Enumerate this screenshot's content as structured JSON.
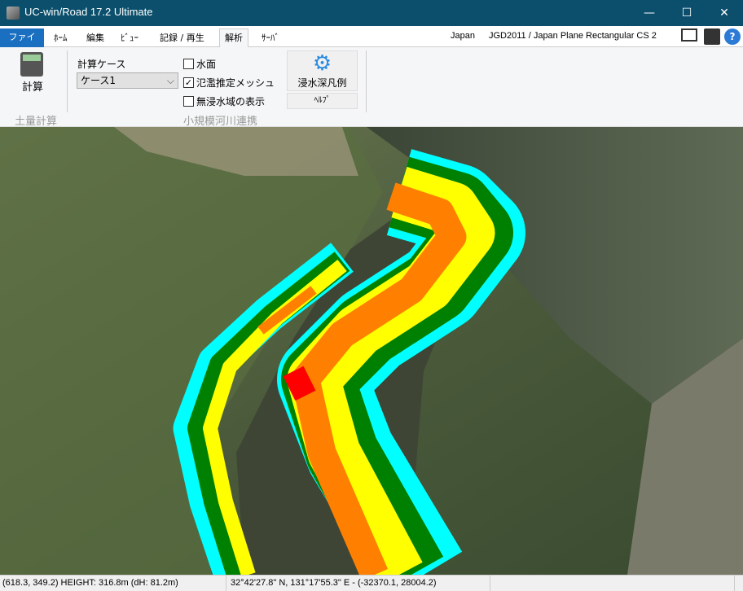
{
  "window": {
    "title": "UC-win/Road 17.2 Ultimate",
    "minimize": "—",
    "maximize": "☐",
    "close": "✕"
  },
  "tabs": [
    {
      "label": "ファイル"
    },
    {
      "label": "ﾎｰﾑ"
    },
    {
      "label": "編集"
    },
    {
      "label": "ﾋﾞｭｰ"
    },
    {
      "label": "記録 / 再生"
    },
    {
      "label": "解析"
    },
    {
      "label": "ｻｰﾊﾞ"
    }
  ],
  "header": {
    "region": "Japan",
    "crs": "JGD2011 / Japan Plane Rectangular CS 2"
  },
  "ribbon": {
    "calc_button": "計算",
    "group1": "土量計算",
    "case_label": "計算ケース",
    "case_value": "ケース1",
    "checkboxes": [
      {
        "label": "水面",
        "checked": false
      },
      {
        "label": "氾濫推定メッシュ",
        "checked": true
      },
      {
        "label": "無浸水域の表示",
        "checked": false
      }
    ],
    "legend_button": "浸水深凡例",
    "help_button": "ﾍﾙﾌﾟ",
    "group2": "小規模河川連携"
  },
  "colors": {
    "titlebar": "#0b4f6c",
    "file_tab": "#1a6fc0",
    "depth": [
      "#ff0000",
      "#ff8000",
      "#ffff00",
      "#008000",
      "#00ffff",
      "#0000ff"
    ]
  },
  "status": {
    "cursor": "(618.3, 349.2)  HEIGHT: 316.8m (dH: 81.2m)",
    "geo": "32°42'27.8\" N, 131°17'55.3\" E  -  (-32370.1, 28004.2)"
  }
}
